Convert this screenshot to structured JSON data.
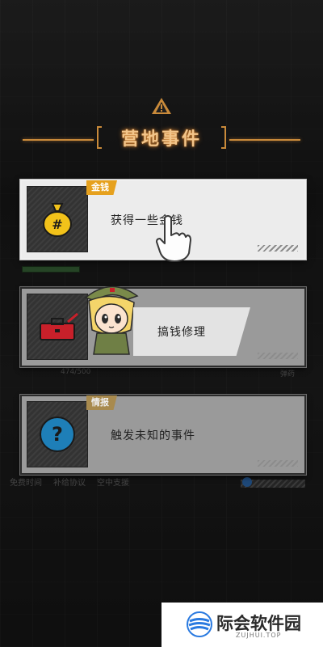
{
  "header": {
    "title": "营地事件"
  },
  "events": [
    {
      "tag": "金钱",
      "text": "获得一些金钱",
      "icon": "coin-bag-icon",
      "state": "active"
    },
    {
      "tag": "",
      "text": "搞钱修理",
      "icon": "toolbox-icon",
      "state": "dim"
    },
    {
      "tag": "情报",
      "text": "触发未知的事件",
      "icon": "question-icon",
      "state": "dim"
    }
  ],
  "hud": {
    "hp_text": "474/500",
    "right_label": "弹药",
    "bottom_labels": [
      "免费时间",
      "补给协议",
      "空中支援"
    ]
  },
  "watermark": {
    "name": "际会软件园",
    "domain": "ZUJHUI.TOP"
  },
  "colors": {
    "accent": "#e6a11e",
    "title_glow": "#f2c58a",
    "icon_yellow": "#f2c21a",
    "icon_blue": "#1e7fb8",
    "toolbox_red": "#c8202a"
  }
}
